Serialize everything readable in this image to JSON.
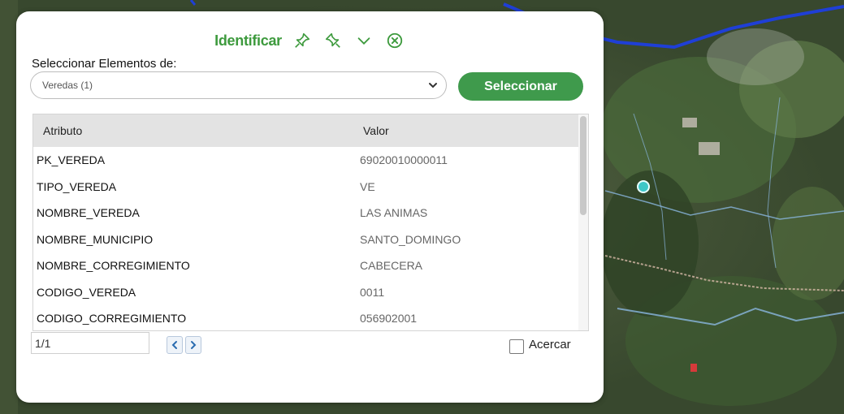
{
  "panel": {
    "title": "Identificar",
    "toolbar_icons": [
      "pin-icon",
      "pin-outline-icon",
      "chevron-down-icon",
      "close-circle-icon"
    ]
  },
  "selector": {
    "label": "Seleccionar Elementos de:",
    "selected": "Veredas (1)",
    "button": "Seleccionar"
  },
  "table": {
    "headers": [
      "Atributo",
      "Valor"
    ],
    "rows": [
      [
        "PK_VEREDA",
        "69020010000011"
      ],
      [
        "TIPO_VEREDA",
        "VE"
      ],
      [
        "NOMBRE_VEREDA",
        "LAS ANIMAS"
      ],
      [
        "NOMBRE_MUNICIPIO",
        "SANTO_DOMINGO"
      ],
      [
        "NOMBRE_CORREGIMIENTO",
        "CABECERA"
      ],
      [
        "CODIGO_VEREDA",
        "0011"
      ],
      [
        "CODIGO_CORREGIMIENTO",
        "056902001"
      ]
    ]
  },
  "pager": {
    "value": "1/1",
    "prev_icon": "chevron-left-icon",
    "next_icon": "chevron-right-icon"
  },
  "zoom_option": {
    "label": "Acercar",
    "checked": false
  },
  "colors": {
    "accent_green": "#3f9a4c",
    "title_green": "#3d9a3d",
    "boundary_blue": "#1f3fd6",
    "marker_teal": "#3ec7c7"
  }
}
